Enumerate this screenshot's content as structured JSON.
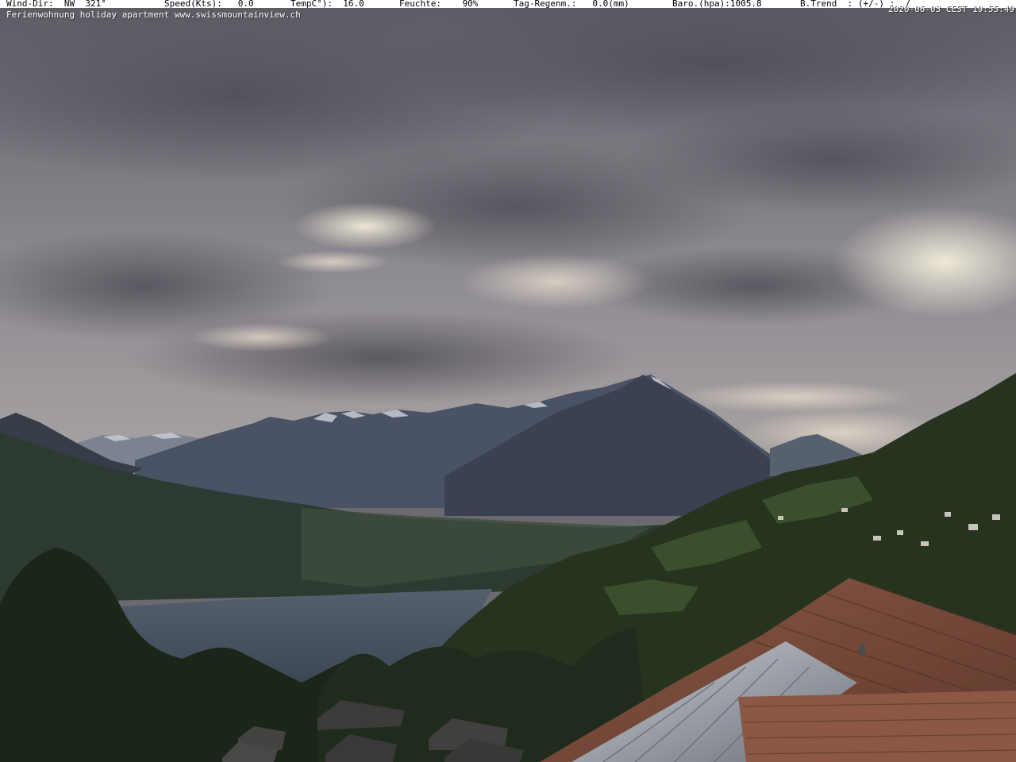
{
  "overlay": {
    "wind_dir": "Wind-Dir:  NW  321°",
    "speed": "Speed(Kts):   0.0",
    "temp": "TempC°):  16.0",
    "humidity": "Feuchte:    90%",
    "rain": "Tag-Regenm.:   0.0(mm)",
    "baro": "Baro.(hpa):1005.8",
    "trend": "B.Trend  : (+/-) :  /",
    "subtitle": "Ferienwohnung holiday apartment www.swissmountainview.ch",
    "timestamp": "2020-06-03 CEST 19:55:49"
  },
  "scene": {
    "colors": {
      "sky_top": "#5d5c63",
      "sky_mid": "#8f8c92",
      "sky_glow": "#e8e2cf",
      "mountains_far": "#4a5466",
      "mountain_main": "#3b4252",
      "hills": "#2c3a2c",
      "lake": "#485361",
      "forest": "#1e2a1c",
      "roof": "#7a4a38"
    }
  }
}
